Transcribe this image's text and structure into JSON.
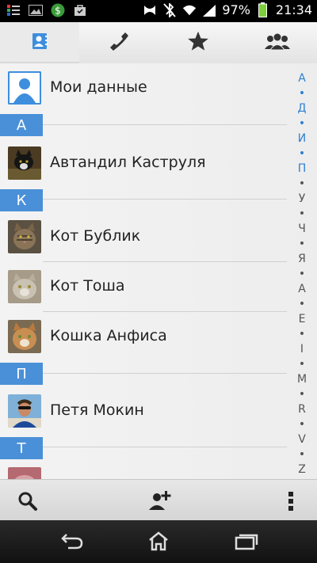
{
  "status_bar": {
    "battery": "97%",
    "time": "21:34"
  },
  "tabs": [
    {
      "name": "contacts",
      "icon": "contact-card-icon",
      "active": true
    },
    {
      "name": "phone",
      "icon": "phone-handset-icon",
      "active": false
    },
    {
      "name": "favorites",
      "icon": "star-icon",
      "active": false
    },
    {
      "name": "groups",
      "icon": "group-icon",
      "active": false
    }
  ],
  "contacts": {
    "my_profile": "Мои данные",
    "sections": [
      {
        "letter": "А",
        "items": [
          "Автандил Каструля"
        ]
      },
      {
        "letter": "К",
        "items": [
          "Кот Бублик",
          "Кот Тоша",
          "Кошка Анфиса"
        ]
      },
      {
        "letter": "П",
        "items": [
          "Петя Мокин"
        ]
      },
      {
        "letter": "Т",
        "items": []
      }
    ]
  },
  "alphabet_index": [
    "А",
    "•",
    "Д",
    "•",
    "И",
    "•",
    "П",
    "•",
    "У",
    "•",
    "Ч",
    "•",
    "Я",
    "•",
    "A",
    "•",
    "E",
    "•",
    "I",
    "•",
    "M",
    "•",
    "R",
    "•",
    "V",
    "•",
    "Z",
    "#"
  ],
  "alphabet_highlight_count": 7,
  "bottom_bar": {
    "search": "search-icon",
    "add_contact": "add-contact-icon",
    "menu": "overflow-menu-icon"
  },
  "navigation": [
    "back-icon",
    "home-icon",
    "recent-apps-icon"
  ],
  "colors": {
    "accent": "#4a90d8",
    "status_bg": "#000000"
  }
}
